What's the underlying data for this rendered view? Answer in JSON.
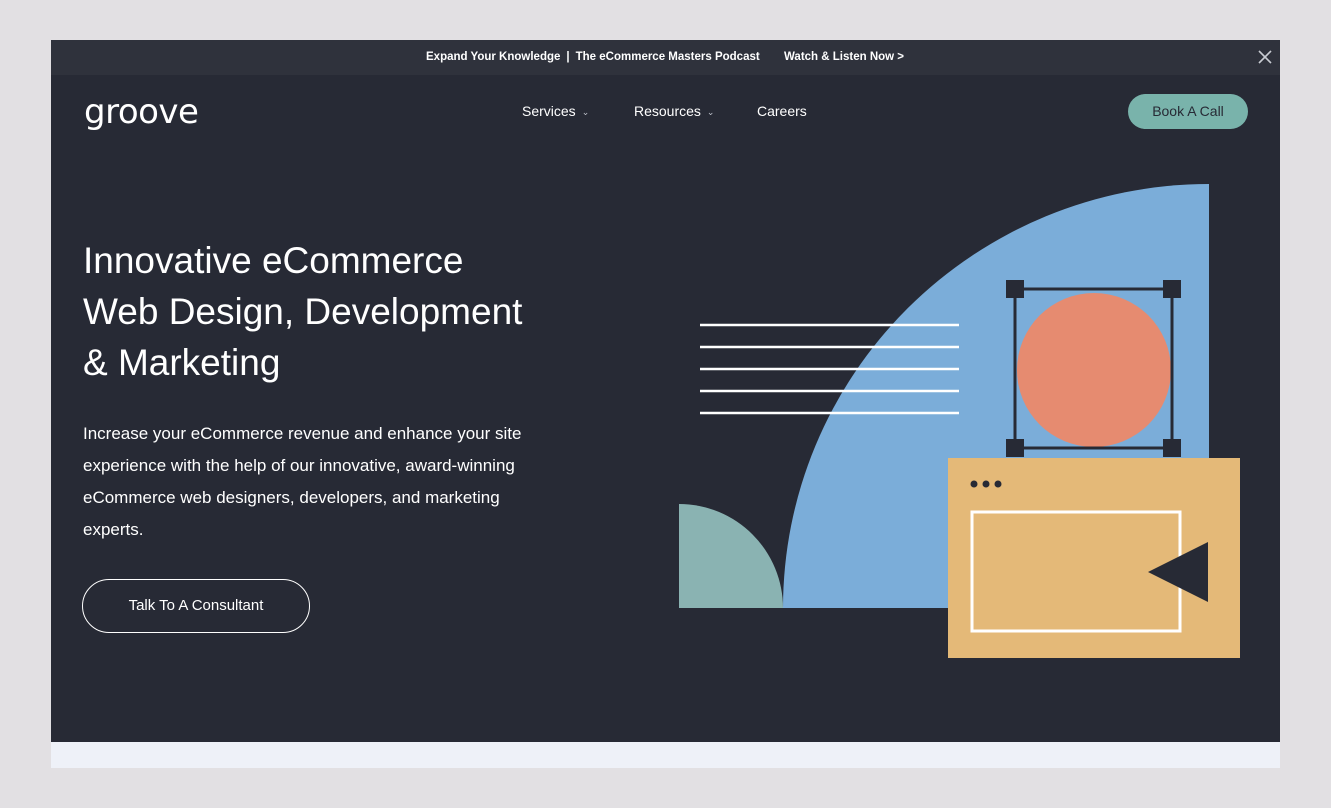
{
  "announcement": {
    "left": "Expand Your Knowledge",
    "separator": "|",
    "right": "The eCommerce Masters Podcast",
    "cta": "Watch & Listen Now >"
  },
  "brand": {
    "logo": "groove"
  },
  "nav": {
    "items": [
      {
        "label": "Services",
        "has_dropdown": true
      },
      {
        "label": "Resources",
        "has_dropdown": true
      },
      {
        "label": "Careers",
        "has_dropdown": false
      }
    ],
    "cta": "Book A Call"
  },
  "hero": {
    "title_lines": [
      "Innovative eCommerce",
      "Web Design, Development",
      "& Marketing"
    ],
    "subtitle_lines": [
      "Increase your eCommerce revenue and enhance your site",
      "experience with the help of our innovative, award-winning",
      "eCommerce web designers, developers, and marketing",
      "experts."
    ],
    "cta": "Talk To A Consultant"
  },
  "colors": {
    "background": "#272a35",
    "announcement_bar": "#2f323c",
    "accent_teal": "#79b3ab",
    "illus_blue": "#7badd9",
    "illus_coral": "#e68b70",
    "illus_sand": "#e4b978",
    "illus_sage": "#8ab3b2"
  },
  "icons": {
    "close": "close-icon",
    "chevron": "chevron-down-icon"
  }
}
